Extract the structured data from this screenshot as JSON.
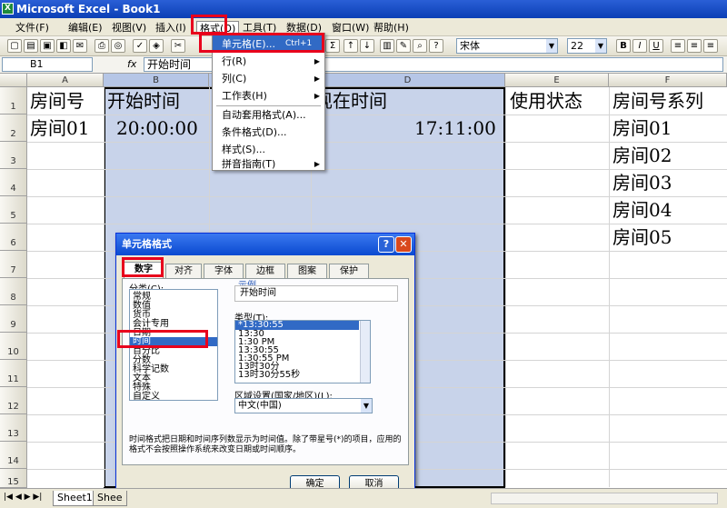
{
  "window": {
    "title": "Microsoft Excel - Book1",
    "app_icon": "X"
  },
  "menu": [
    "文件(F)",
    "编辑(E)",
    "视图(V)",
    "插入(I)",
    "格式(O)",
    "工具(T)",
    "数据(D)",
    "窗口(W)",
    "帮助(H)"
  ],
  "toolbar": {
    "font_name": "宋体",
    "font_size": "22",
    "sum_label": "Σ",
    "bold": "B",
    "italic": "I",
    "underline": "U"
  },
  "formula_bar": {
    "name_box": "B1",
    "fx": "fx",
    "value": "开始时间"
  },
  "columns": [
    "A",
    "B",
    "C",
    "D",
    "E",
    "F"
  ],
  "rows": [
    "1",
    "2",
    "3",
    "4",
    "5",
    "6",
    "7",
    "8",
    "9",
    "10",
    "11",
    "12",
    "13",
    "14",
    "15"
  ],
  "cells": {
    "A1": "房间号",
    "B1": "开始时间",
    "D1": "现在时间",
    "E1": "使用状态",
    "F1": "房间号系列",
    "A2": "房间01",
    "B2": "20:00:00",
    "D2": "17:11:00",
    "F2": "房间01",
    "F3": "房间02",
    "F4": "房间03",
    "F5": "房间04",
    "F6": "房间05"
  },
  "format_menu": [
    {
      "label": "单元格(E)...",
      "shortcut": "Ctrl+1"
    },
    {
      "label": "行(R)",
      "sub": "▶"
    },
    {
      "label": "列(C)",
      "sub": "▶"
    },
    {
      "label": "工作表(H)",
      "sub": "▶"
    },
    {
      "label": "自动套用格式(A)..."
    },
    {
      "label": "条件格式(D)..."
    },
    {
      "label": "样式(S)..."
    },
    {
      "label": "拼音指南(T)",
      "sub": "▶"
    }
  ],
  "dialog": {
    "title": "单元格格式",
    "help": "?",
    "close": "✕",
    "tabs": [
      "数字",
      "对齐",
      "字体",
      "边框",
      "图案",
      "保护"
    ],
    "category_label": "分类(C):",
    "categories": [
      "常规",
      "数值",
      "货币",
      "会计专用",
      "日期",
      "时间",
      "百分比",
      "分数",
      "科学记数",
      "文本",
      "特殊",
      "自定义"
    ],
    "selected_category": "时间",
    "sample_label": "示例",
    "sample_value": "开始时间",
    "type_label": "类型(T):",
    "types": [
      "*13:30:55",
      "13:30",
      "1:30 PM",
      "13:30:55",
      "1:30:55 PM",
      "13时30分",
      "13时30分55秒"
    ],
    "locale_label": "区域设置(国家/地区)(L):",
    "locale_value": "中文(中国)",
    "description": "时间格式把日期和时间序列数显示为时间值。除了带星号(*)的项目，应用的格式不会按照操作系统来改变日期或时间顺序。",
    "ok": "确定",
    "cancel": "取消"
  },
  "sheet_tabs": [
    "Sheet1",
    "Shee"
  ],
  "accent": "#e8001c"
}
